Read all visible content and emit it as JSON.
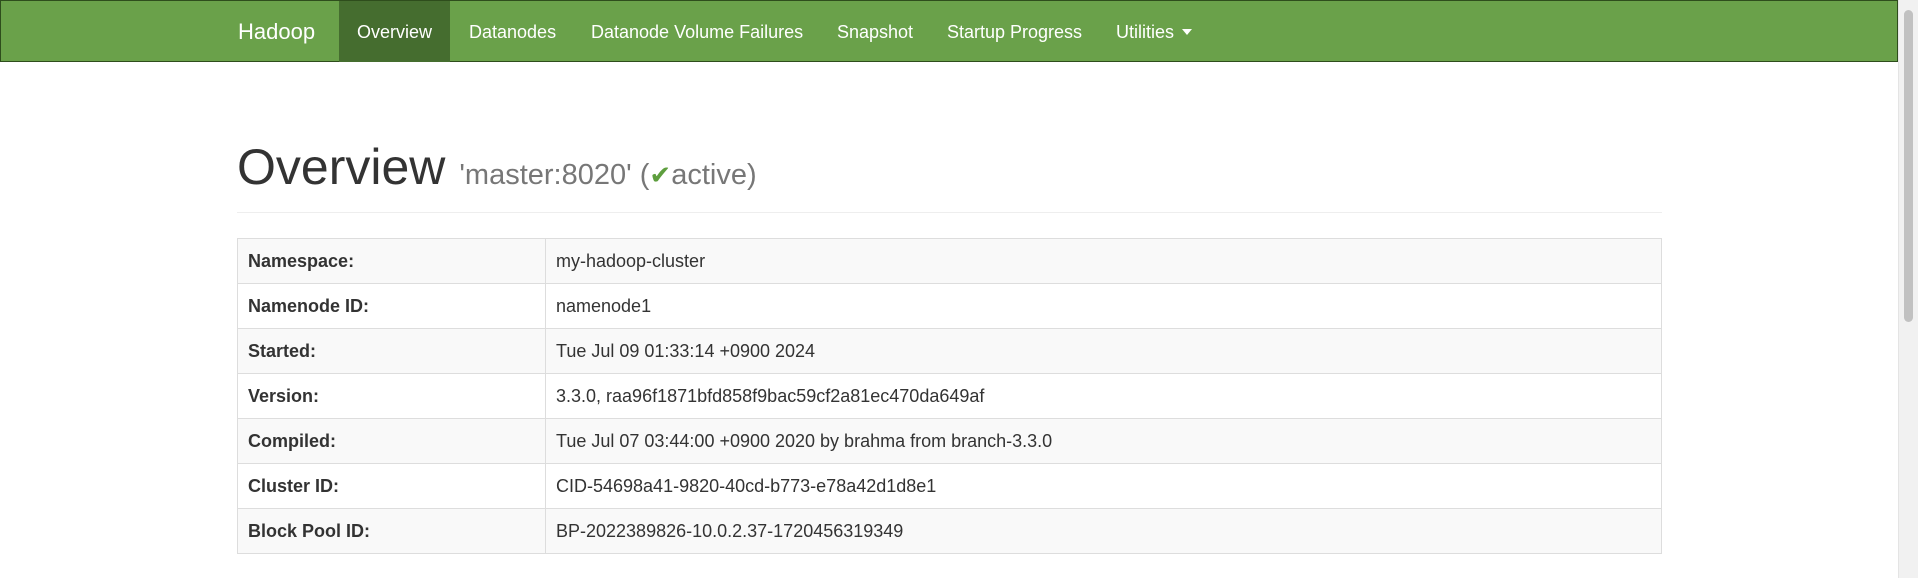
{
  "navbar": {
    "brand": "Hadoop",
    "items": [
      {
        "label": "Overview",
        "active": true
      },
      {
        "label": "Datanodes"
      },
      {
        "label": "Datanode Volume Failures"
      },
      {
        "label": "Snapshot"
      },
      {
        "label": "Startup Progress"
      },
      {
        "label": "Utilities",
        "dropdown": true
      }
    ],
    "colors": {
      "background": "#6aa14a",
      "active": "#456d2f"
    }
  },
  "page": {
    "title": "Overview",
    "host": "'master:8020'",
    "status_open": "(",
    "status_icon": "checkmark-icon",
    "status": "active",
    "status_close": ")"
  },
  "info_rows": [
    {
      "label": "Namespace:",
      "value": "my-hadoop-cluster"
    },
    {
      "label": "Namenode ID:",
      "value": "namenode1"
    },
    {
      "label": "Started:",
      "value": "Tue Jul 09 01:33:14 +0900 2024"
    },
    {
      "label": "Version:",
      "value": "3.3.0, raa96f1871bfd858f9bac59cf2a81ec470da649af"
    },
    {
      "label": "Compiled:",
      "value": "Tue Jul 07 03:44:00 +0900 2020 by brahma from branch-3.3.0"
    },
    {
      "label": "Cluster ID:",
      "value": "CID-54698a41-9820-40cd-b773-e78a42d1d8e1"
    },
    {
      "label": "Block Pool ID:",
      "value": "BP-2022389826-10.0.2.37-1720456319349"
    }
  ]
}
